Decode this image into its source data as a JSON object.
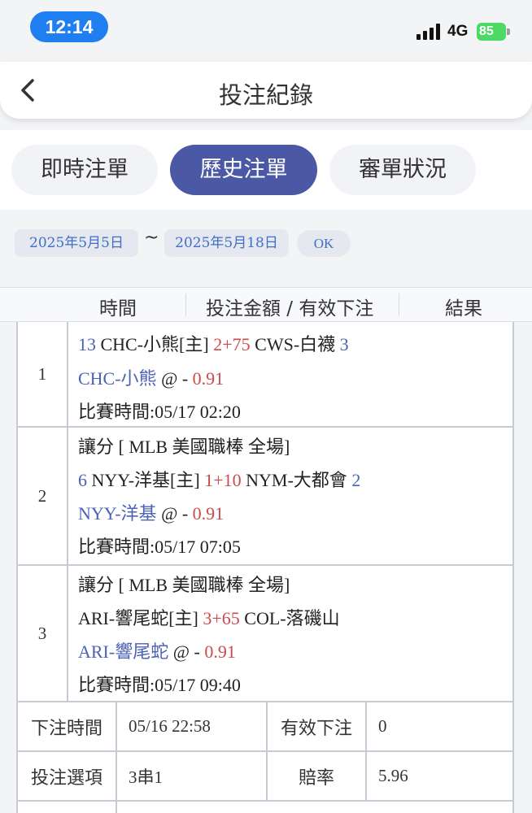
{
  "status_bar": {
    "time": "12:14",
    "network": "4G",
    "battery": "85"
  },
  "header": {
    "title": "投注紀錄"
  },
  "tabs": [
    {
      "label": "即時注單",
      "active": false
    },
    {
      "label": "歷史注單",
      "active": true
    },
    {
      "label": "審單狀況",
      "active": false
    }
  ],
  "filter": {
    "date_from": "2025年5月5日",
    "separator": "~",
    "date_to": "2025年5月18日",
    "ok_label": "OK"
  },
  "table": {
    "columns": [
      "時間",
      "投注金額 / 有效下注",
      "結果"
    ],
    "rows": [
      {
        "index": "1",
        "match": {
          "home_num": "13",
          "home": "CHC-小熊[主]",
          "handicap": "2+75",
          "away": "CWS-白襪",
          "away_num": "3"
        },
        "pick": {
          "team": "CHC-小熊",
          "at": "@ -",
          "odds": "0.91"
        },
        "time": "比賽時間:05/17 02:20"
      },
      {
        "index": "2",
        "league": "讓分 [ MLB 美國職棒 全場]",
        "match": {
          "home_num": "6",
          "home": "NYY-洋基[主]",
          "handicap": "1+10",
          "away": "NYM-大都會",
          "away_num": "2"
        },
        "pick": {
          "team": "NYY-洋基",
          "at": "@ -",
          "odds": "0.91"
        },
        "time": "比賽時間:05/17 07:05"
      },
      {
        "index": "3",
        "league": "讓分 [ MLB 美國職棒 全場]",
        "match": {
          "home_num": "",
          "home": "ARI-響尾蛇[主]",
          "handicap": "3+65",
          "away": "COL-落磯山",
          "away_num": ""
        },
        "pick": {
          "team": "ARI-響尾蛇",
          "at": "@ -",
          "odds": "0.91"
        },
        "time": "比賽時間:05/17 09:40"
      }
    ],
    "summary": {
      "bet_time_label": "下注時間",
      "bet_time": "05/16 22:58",
      "valid_bet_label": "有效下注",
      "valid_bet": "0",
      "option_label": "投注選項",
      "option": "3串1",
      "odds_label": "賠率",
      "odds": "5.96"
    }
  },
  "colors": {
    "accent": "#4a58a6",
    "link_blue": "#4b62b5",
    "handicap_red": "#cc4b4b",
    "status_pill": "#1f7ff0"
  }
}
